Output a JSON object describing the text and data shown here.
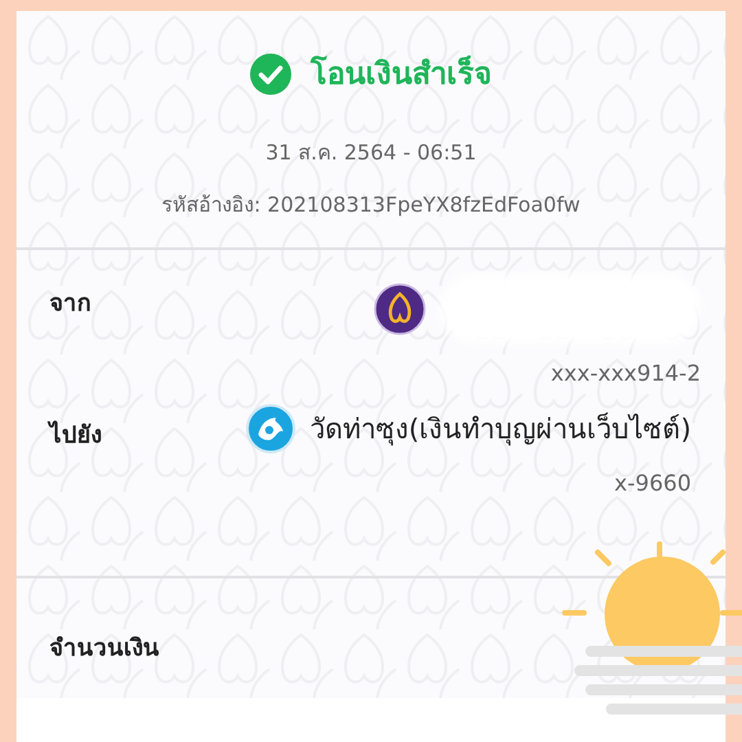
{
  "header": {
    "success": true,
    "status": "โอนเงินสำเร็จ",
    "datetime": "31 ส.ค. 2564 - 06:51",
    "reference": "รหัสอ้างอิง: 202108313FpeYX8fzEdFoa0fw"
  },
  "parties": [
    {
      "label": "จาก",
      "name_hidden": true,
      "account": "xxx-xxx914-2"
    },
    {
      "label": "ไปยัง",
      "name_hidden": false,
      "name": "วัดท่าซุง(เงินทำบุญผ่านเว็บไซต์)",
      "account": "x-9660"
    }
  ],
  "amount": {
    "label": "จำนวนเงิน"
  }
}
